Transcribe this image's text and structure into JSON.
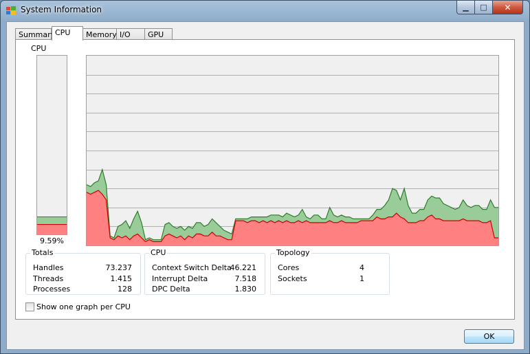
{
  "window": {
    "title": "System Information",
    "controls": {
      "minimize": "▁",
      "maximize": "□",
      "close": "✕"
    }
  },
  "tabs": [
    {
      "label": "Summary",
      "active": false
    },
    {
      "label": "CPU",
      "active": true
    },
    {
      "label": "Memory",
      "active": false
    },
    {
      "label": "I/O",
      "active": false
    },
    {
      "label": "GPU",
      "active": false
    }
  ],
  "cpu_meter": {
    "label": "CPU",
    "percent_text": "9.59%",
    "total_fraction": 0.0959,
    "kernel_fraction": 0.053
  },
  "chart_data": {
    "type": "area",
    "ylim": [
      0,
      100
    ],
    "grid": true,
    "series": [
      {
        "color": "#2e7d2e",
        "fill": "#99cc99",
        "values": [
          32,
          31,
          33,
          34,
          40,
          32,
          5,
          4,
          10,
          11,
          13,
          9,
          14,
          18,
          12,
          3,
          4,
          3,
          3,
          3,
          11,
          12,
          10,
          9,
          10,
          8,
          10,
          9,
          12,
          12,
          10,
          11,
          14,
          12,
          10,
          8,
          7,
          6,
          14,
          14,
          14,
          14,
          15,
          15,
          15,
          15,
          15,
          16,
          16,
          16,
          15,
          17,
          16,
          15,
          16,
          19,
          15,
          14,
          16,
          16,
          14,
          14,
          20,
          16,
          15,
          16,
          15,
          15,
          14,
          14,
          14,
          14,
          14,
          16,
          19,
          19,
          21,
          24,
          30,
          29,
          24,
          30,
          21,
          17,
          17,
          19,
          19,
          24,
          26,
          25,
          25,
          22,
          21,
          20,
          19,
          20,
          24,
          21,
          20,
          21,
          21,
          19,
          19,
          24,
          20,
          20
        ]
      },
      {
        "color": "#cc0000",
        "fill": "#ff8080",
        "values": [
          28,
          27,
          28,
          29,
          27,
          24,
          4,
          3,
          5,
          4,
          5,
          3,
          5,
          6,
          4,
          2,
          3,
          2,
          2,
          2,
          5,
          6,
          5,
          4,
          5,
          3,
          5,
          4,
          6,
          6,
          5,
          5,
          7,
          5,
          5,
          4,
          3,
          3,
          13,
          13,
          13,
          12,
          13,
          13,
          12,
          13,
          12,
          13,
          12,
          13,
          12,
          13,
          12,
          12,
          13,
          12,
          13,
          12,
          12,
          12,
          12,
          12,
          13,
          12,
          12,
          13,
          12,
          12,
          12,
          12,
          13,
          13,
          13,
          13,
          15,
          14,
          14,
          15,
          15,
          17,
          15,
          14,
          12,
          12,
          12,
          13,
          13,
          15,
          16,
          14,
          14,
          13,
          13,
          13,
          13,
          13,
          14,
          13,
          13,
          13,
          13,
          12,
          12,
          13,
          4,
          4
        ]
      }
    ]
  },
  "totals": {
    "title": "Totals",
    "rows": [
      {
        "label": "Handles",
        "value": "73.237"
      },
      {
        "label": "Threads",
        "value": "1.415"
      },
      {
        "label": "Processes",
        "value": "128"
      }
    ]
  },
  "cpu_group": {
    "title": "CPU",
    "rows": [
      {
        "label": "Context Switch Delta",
        "value": "46.221"
      },
      {
        "label": "Interrupt Delta",
        "value": "7.518"
      },
      {
        "label": "DPC Delta",
        "value": "1.830"
      }
    ]
  },
  "topology": {
    "title": "Topology",
    "rows": [
      {
        "label": "Cores",
        "value": "4"
      },
      {
        "label": "Sockets",
        "value": "1"
      }
    ]
  },
  "options": {
    "one_graph_per_cpu_label": "Show one graph per CPU",
    "one_graph_per_cpu_checked": false
  },
  "buttons": {
    "ok": "OK"
  }
}
